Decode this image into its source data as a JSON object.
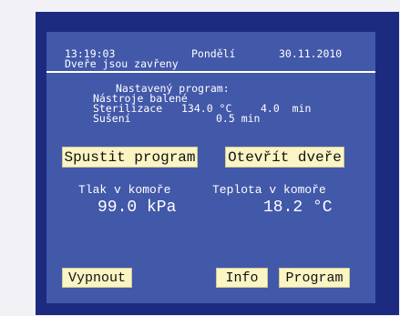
{
  "header": {
    "time": "13:19:03",
    "day": "Pondělí",
    "date": "30.11.2010",
    "door_status": "Dveře jsou zavřeny"
  },
  "program": {
    "title": "Nastavený program:",
    "name": "Nástroje balené",
    "sterilization_label": "Sterilizace",
    "sterilization_temp": "134.0 °C",
    "sterilization_time": "4.0  min",
    "drying_label": "Sušení",
    "drying_time": "0.5 min"
  },
  "buttons": {
    "start_program": "Spustit program",
    "open_door": "Otevřít dveře",
    "turn_off": "Vypnout",
    "info": "Info",
    "program": "Program"
  },
  "readouts": {
    "pressure_label": "Tlak v komoře",
    "pressure_value": "99.0 kPa",
    "temperature_label": "Teplota v komoře",
    "temperature_value": "18.2 °C"
  },
  "colors": {
    "frame": "#1c2a80",
    "panel": "#4258a9",
    "button": "#fbf5c4",
    "text": "#ffffff"
  }
}
